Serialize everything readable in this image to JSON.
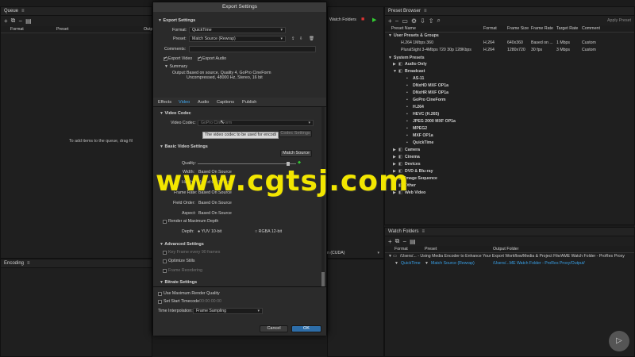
{
  "queue": {
    "title": "Queue",
    "columns": [
      "Format",
      "Preset",
      "Output"
    ],
    "empty_text": "To add items to the queue, drag fil"
  },
  "encoding": {
    "title": "Encoding",
    "gpu_text": "n (CUDA)"
  },
  "queue_toolbar": {
    "watch_folders": "Watch Folders"
  },
  "preset_browser": {
    "title": "Preset Browser",
    "apply_label": "Apply Preset",
    "columns": [
      "Preset Name",
      "Format",
      "Frame Size",
      "Frame Rate",
      "Target Rate",
      "Comment"
    ],
    "user_group": "User Presets & Groups",
    "user_presets": [
      {
        "name": "H.264 1Mbps 360",
        "format": "H.264",
        "frame_size": "640x360",
        "frame_rate": "Based on ...",
        "target_rate": "1 Mbps",
        "comment": "Custom"
      },
      {
        "name": "PluralSight 3-4Mbps 720 30p 128Kbps",
        "format": "H.264",
        "frame_size": "1280x720",
        "frame_rate": "30 fps",
        "target_rate": "3 Mbps",
        "comment": "Custom"
      }
    ],
    "system_group": "System Presets",
    "tree": [
      {
        "label": "Audio Only",
        "level": 1,
        "open": false
      },
      {
        "label": "Broadcast",
        "level": 1,
        "open": true
      },
      {
        "label": "AS-11",
        "level": 2,
        "open": false
      },
      {
        "label": "DNxHD MXF OP1a",
        "level": 2,
        "open": false
      },
      {
        "label": "DNxHR MXF OP1a",
        "level": 2,
        "open": false
      },
      {
        "label": "GoPro CineForm",
        "level": 2,
        "open": false
      },
      {
        "label": "H.264",
        "level": 2,
        "open": false
      },
      {
        "label": "HEVC (H.265)",
        "level": 2,
        "open": false
      },
      {
        "label": "JPEG 2000 MXF OP1a",
        "level": 2,
        "open": false
      },
      {
        "label": "MPEG2",
        "level": 2,
        "open": false
      },
      {
        "label": "MXF OP1a",
        "level": 2,
        "open": false
      },
      {
        "label": "QuickTime",
        "level": 2,
        "open": false
      },
      {
        "label": "Camera",
        "level": 1,
        "open": false
      },
      {
        "label": "Cinema",
        "level": 1,
        "open": false
      },
      {
        "label": "Devices",
        "level": 1,
        "open": false
      },
      {
        "label": "DVD & Blu-ray",
        "level": 1,
        "open": false
      },
      {
        "label": "Image Sequence",
        "level": 1,
        "open": false
      },
      {
        "label": "Other",
        "level": 1,
        "open": false
      },
      {
        "label": "Web Video",
        "level": 1,
        "open": false
      }
    ]
  },
  "watch_folders": {
    "title": "Watch Folders",
    "columns": [
      "Format",
      "Preset",
      "Output Folder"
    ],
    "folder_path": "/Users/... - Using Media Encoder to Enhance Your Export Workflow/Media & Project File/AME Watch Folder - ProRes Proxy",
    "format": "QuickTime",
    "preset": "Match Source (Rewrap)",
    "output": "/Users/...ME Watch Folder - ProRes Proxy/Output/"
  },
  "dialog": {
    "title": "Export Settings",
    "export_settings": "Export Settings",
    "format_label": "Format:",
    "format_value": "QuickTime",
    "preset_label": "Preset:",
    "preset_value": "Match Source (Rewrap)",
    "comments_label": "Comments:",
    "export_video": "Export Video",
    "export_audio": "Export Audio",
    "summary_label": "Summary",
    "output_label": "Output:",
    "output_line1": "Based on source, Quality 4, GoPro CineForm",
    "output_line2": "Uncompressed, 48000 Hz, Stereo, 16 bit",
    "tabs": [
      "Effects",
      "Video",
      "Audio",
      "Captions",
      "Publish"
    ],
    "video_codec_section": "Video Codec",
    "video_codec_label": "Video Codec:",
    "video_codec_value": "GoPro CineForm",
    "tooltip": "The video codec to be used for encodi",
    "codec_settings": "Codec Settings",
    "basic_section": "Basic Video Settings",
    "match_source": "Match Source",
    "quality_label": "Quality:",
    "quality_level": 0.92,
    "fields": [
      {
        "label": "Width:",
        "value": "Based On Source"
      },
      {
        "label": "Height:",
        "value": "Based On Source"
      },
      {
        "label": "Frame Rate:",
        "value": "Based On Source"
      },
      {
        "label": "Field Order:",
        "value": "Based On Source"
      },
      {
        "label": "Aspect:",
        "value": "Based On Source"
      }
    ],
    "render_max_depth": "Render at Maximum Depth",
    "depth_label": "Depth:",
    "depth_yuv": "YUV 10-bit",
    "depth_rgba": "RGBA 12-bit",
    "advanced_section": "Advanced Settings",
    "key_frame": "Key Frame every",
    "key_frame_value": "90 frames",
    "optimize_stills": "Optimize Stills",
    "frame_reordering": "Frame Reordering",
    "bitrate_section": "Bitrate Settings",
    "use_max_render": "Use Maximum Render Quality",
    "set_start_timecode": "Set Start Timecode",
    "timecode_value": "00:00:00:00",
    "time_interp_label": "Time Interpolation:",
    "time_interp_value": "Frame Sampling",
    "cancel": "Cancel",
    "ok": "OK"
  },
  "watermark": "www.cgtsj.com",
  "colors": {
    "accent": "#3fa7ef",
    "watermark": "#f2e600",
    "ok_button": "#2d6da8"
  }
}
